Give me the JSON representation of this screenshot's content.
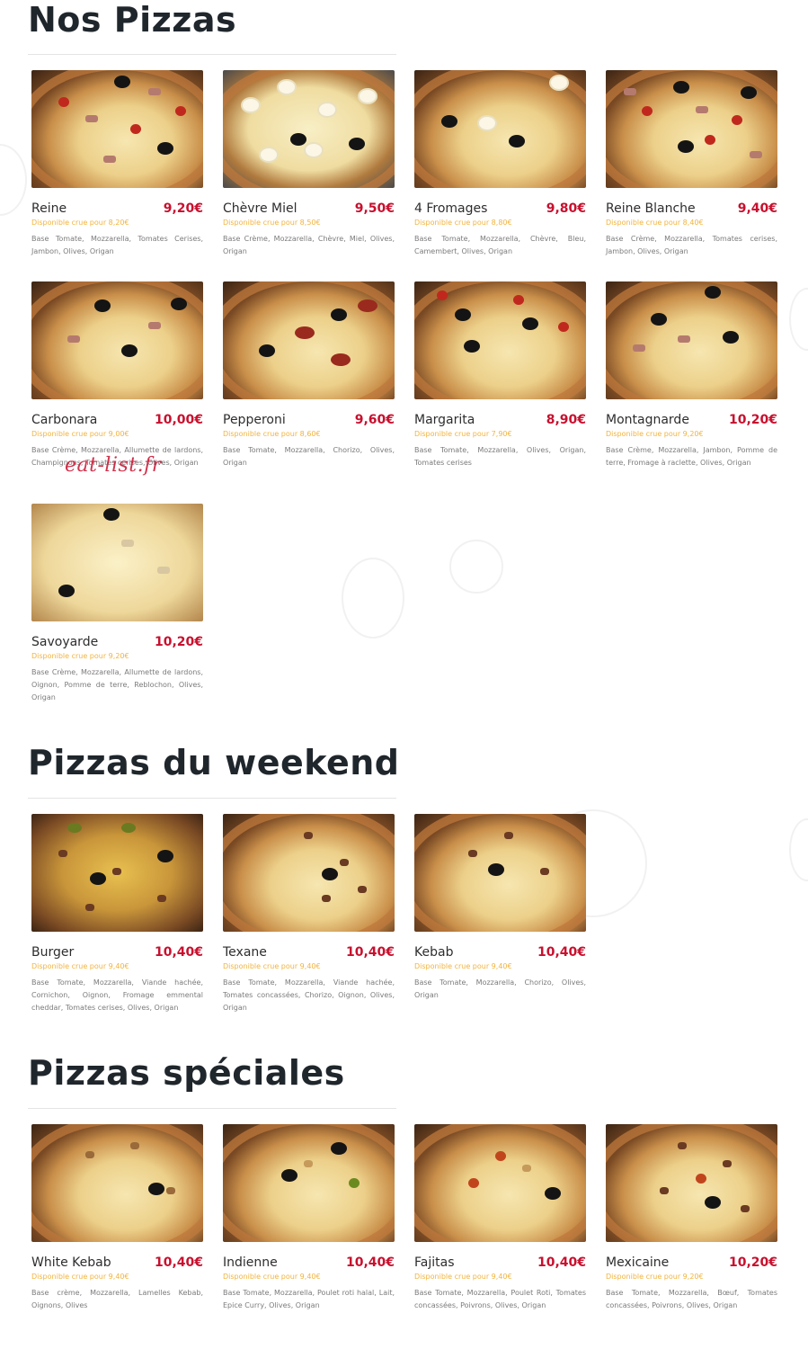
{
  "watermark": "eat-list.fr",
  "sections": [
    {
      "title": "Nos Pizzas",
      "items": [
        {
          "name": "Reine",
          "price": "9,20€",
          "raw": "Disponible crue pour 8,20€",
          "desc": "Base Tomate, Mozzarella, Tomates Cerises, Jambon, Olives, Origan"
        },
        {
          "name": "Chèvre Miel",
          "price": "9,50€",
          "raw": "Disponible crue pour 8,50€",
          "desc": "Base Crème, Mozzarella, Chèvre, Miel, Olives, Origan"
        },
        {
          "name": "4 Fromages",
          "price": "9,80€",
          "raw": "Disponible crue pour 8,80€",
          "desc": "Base Tomate, Mozzarella, Chèvre, Bleu, Camembert, Olives, Origan"
        },
        {
          "name": "Reine Blanche",
          "price": "9,40€",
          "raw": "Disponible crue pour 8,40€",
          "desc": "Base Crème, Mozzarella, Tomates cerises, Jambon, Olives, Origan"
        },
        {
          "name": "Carbonara",
          "price": "10,00€",
          "raw": "Disponible crue pour 9,00€",
          "desc": "Base Crème, Mozzarella, Allumette de lardons, Champignons, Tomates cerises, Olives, Origan"
        },
        {
          "name": "Pepperoni",
          "price": "9,60€",
          "raw": "Disponible crue pour 8,60€",
          "desc": "Base Tomate, Mozzarella, Chorizo, Olives, Origan"
        },
        {
          "name": "Margarita",
          "price": "8,90€",
          "raw": "Disponible crue pour 7,90€",
          "desc": "Base Tomate, Mozzarella, Olives, Origan, Tomates cerises"
        },
        {
          "name": "Montagnarde",
          "price": "10,20€",
          "raw": "Disponible crue pour 9,20€",
          "desc": "Base Crème, Mozzarella, Jambon, Pomme de terre, Fromage à raclette, Olives, Origan"
        },
        {
          "name": "Savoyarde",
          "price": "10,20€",
          "raw": "Disponible crue pour 9,20€",
          "desc": "Base Crème, Mozzarella, Allumette de lardons, Oignon, Pomme de terre, Reblochon, Olives, Origan"
        }
      ]
    },
    {
      "title": "Pizzas du weekend",
      "items": [
        {
          "name": "Burger",
          "price": "10,40€",
          "raw": "Disponible crue pour 9,40€",
          "desc": "Base Tomate, Mozzarella, Viande hachée, Cornichon, Oignon, Fromage emmental cheddar, Tomates cerises, Olives, Origan"
        },
        {
          "name": "Texane",
          "price": "10,40€",
          "raw": "Disponible crue pour 9,40€",
          "desc": "Base Tomate, Mozzarella, Viande hachée, Tomates concassées, Chorizo, Oignon, Olives, Origan"
        },
        {
          "name": "Kebab",
          "price": "10,40€",
          "raw": "Disponible crue pour 9,40€",
          "desc": "Base Tomate, Mozzarella, Chorizo, Olives, Origan"
        }
      ]
    },
    {
      "title": "Pizzas spéciales",
      "items": [
        {
          "name": "White Kebab",
          "price": "10,40€",
          "raw": "Disponible crue pour 9,40€",
          "desc": "Base crème, Mozzarella, Lamelles Kebab, Oignons, Olives"
        },
        {
          "name": "Indienne",
          "price": "10,40€",
          "raw": "Disponible crue pour 9,40€",
          "desc": "Base Tomate, Mozzarella, Poulet roti halal, Lait, Epice Curry, Olives, Origan"
        },
        {
          "name": "Fajitas",
          "price": "10,40€",
          "raw": "Disponible crue pour 9,40€",
          "desc": "Base Tomate, Mozzarella, Poulet Roti, Tomates concassées, Poivrons, Olives, Origan"
        },
        {
          "name": "Mexicaine",
          "price": "10,20€",
          "raw": "Disponible crue pour 9,20€",
          "desc": "Base Tomate, Mozzarella, Bœuf, Tomates concassées, Poivrons, Olives, Origan"
        }
      ]
    }
  ]
}
